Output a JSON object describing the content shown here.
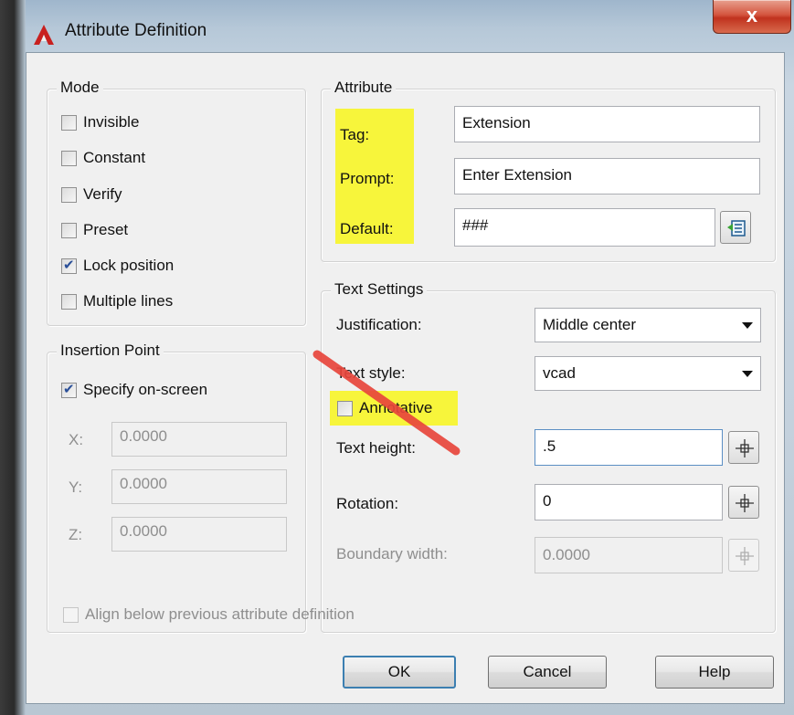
{
  "window": {
    "title": "Attribute Definition",
    "close_glyph": "x"
  },
  "mode": {
    "title": "Mode",
    "items": [
      {
        "label": "Invisible",
        "checked": false
      },
      {
        "label": "Constant",
        "checked": false
      },
      {
        "label": "Verify",
        "checked": false
      },
      {
        "label": "Preset",
        "checked": false
      },
      {
        "label": "Lock position",
        "checked": true
      },
      {
        "label": "Multiple lines",
        "checked": false
      }
    ]
  },
  "insertion_point": {
    "title": "Insertion Point",
    "specify_label": "Specify on-screen",
    "x_label": "X:",
    "y_label": "Y:",
    "z_label": "Z:",
    "x_value": "0.0000",
    "y_value": "0.0000",
    "z_value": "0.0000"
  },
  "attribute": {
    "title": "Attribute",
    "tag_label": "Tag:",
    "tag_value": "Extension",
    "prompt_label": "Prompt:",
    "prompt_value": "Enter Extension",
    "default_label": "Default:",
    "default_value": "###"
  },
  "text_settings": {
    "title": "Text Settings",
    "justification_label": "Justification:",
    "justification_value": "Middle center",
    "text_style_label": "Text style:",
    "text_style_value": "vcad",
    "annotative_label": "Annotative",
    "text_height_label": "Text height:",
    "text_height_value": ".5",
    "rotation_label": "Rotation:",
    "rotation_value": "0",
    "boundary_width_label": "Boundary width:",
    "boundary_width_value": "0.0000"
  },
  "align_label": "Align below previous attribute definition",
  "buttons": {
    "ok": "OK",
    "cancel": "Cancel",
    "help": "Help"
  },
  "colors": {
    "highlight": "#f7f53b",
    "strike": "#e8463c",
    "app_icon": "#c8201f"
  }
}
